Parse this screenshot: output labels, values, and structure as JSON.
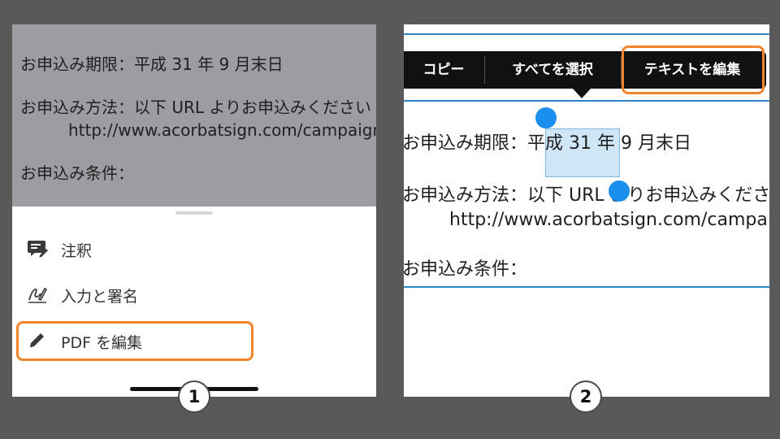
{
  "colors": {
    "background": "#595959",
    "highlight_frame": "#f2842e",
    "selection_handle": "#1a8ff0",
    "selection_fill": "#cfe6f7",
    "rule_line": "#2c86c6"
  },
  "document": {
    "deadline": "お申込み期限：平成 31 年 9 月末日",
    "method": "お申込み方法：以下 URL よりお申込みください",
    "url": "http://www.acorbatsign.com/campaign",
    "conditions": "お申込み条件："
  },
  "panel1": {
    "menu": [
      {
        "icon": "comment-icon",
        "label": "注釈"
      },
      {
        "icon": "fill-sign-icon",
        "label": "入力と署名"
      },
      {
        "icon": "pencil-icon",
        "label": "PDF を編集"
      }
    ],
    "step": "1"
  },
  "panel2": {
    "context_menu": {
      "copy": "コピー",
      "select_all": "すべてを選択",
      "edit_text": "テキストを編集"
    },
    "selected_text": "平成 31",
    "step": "2"
  }
}
